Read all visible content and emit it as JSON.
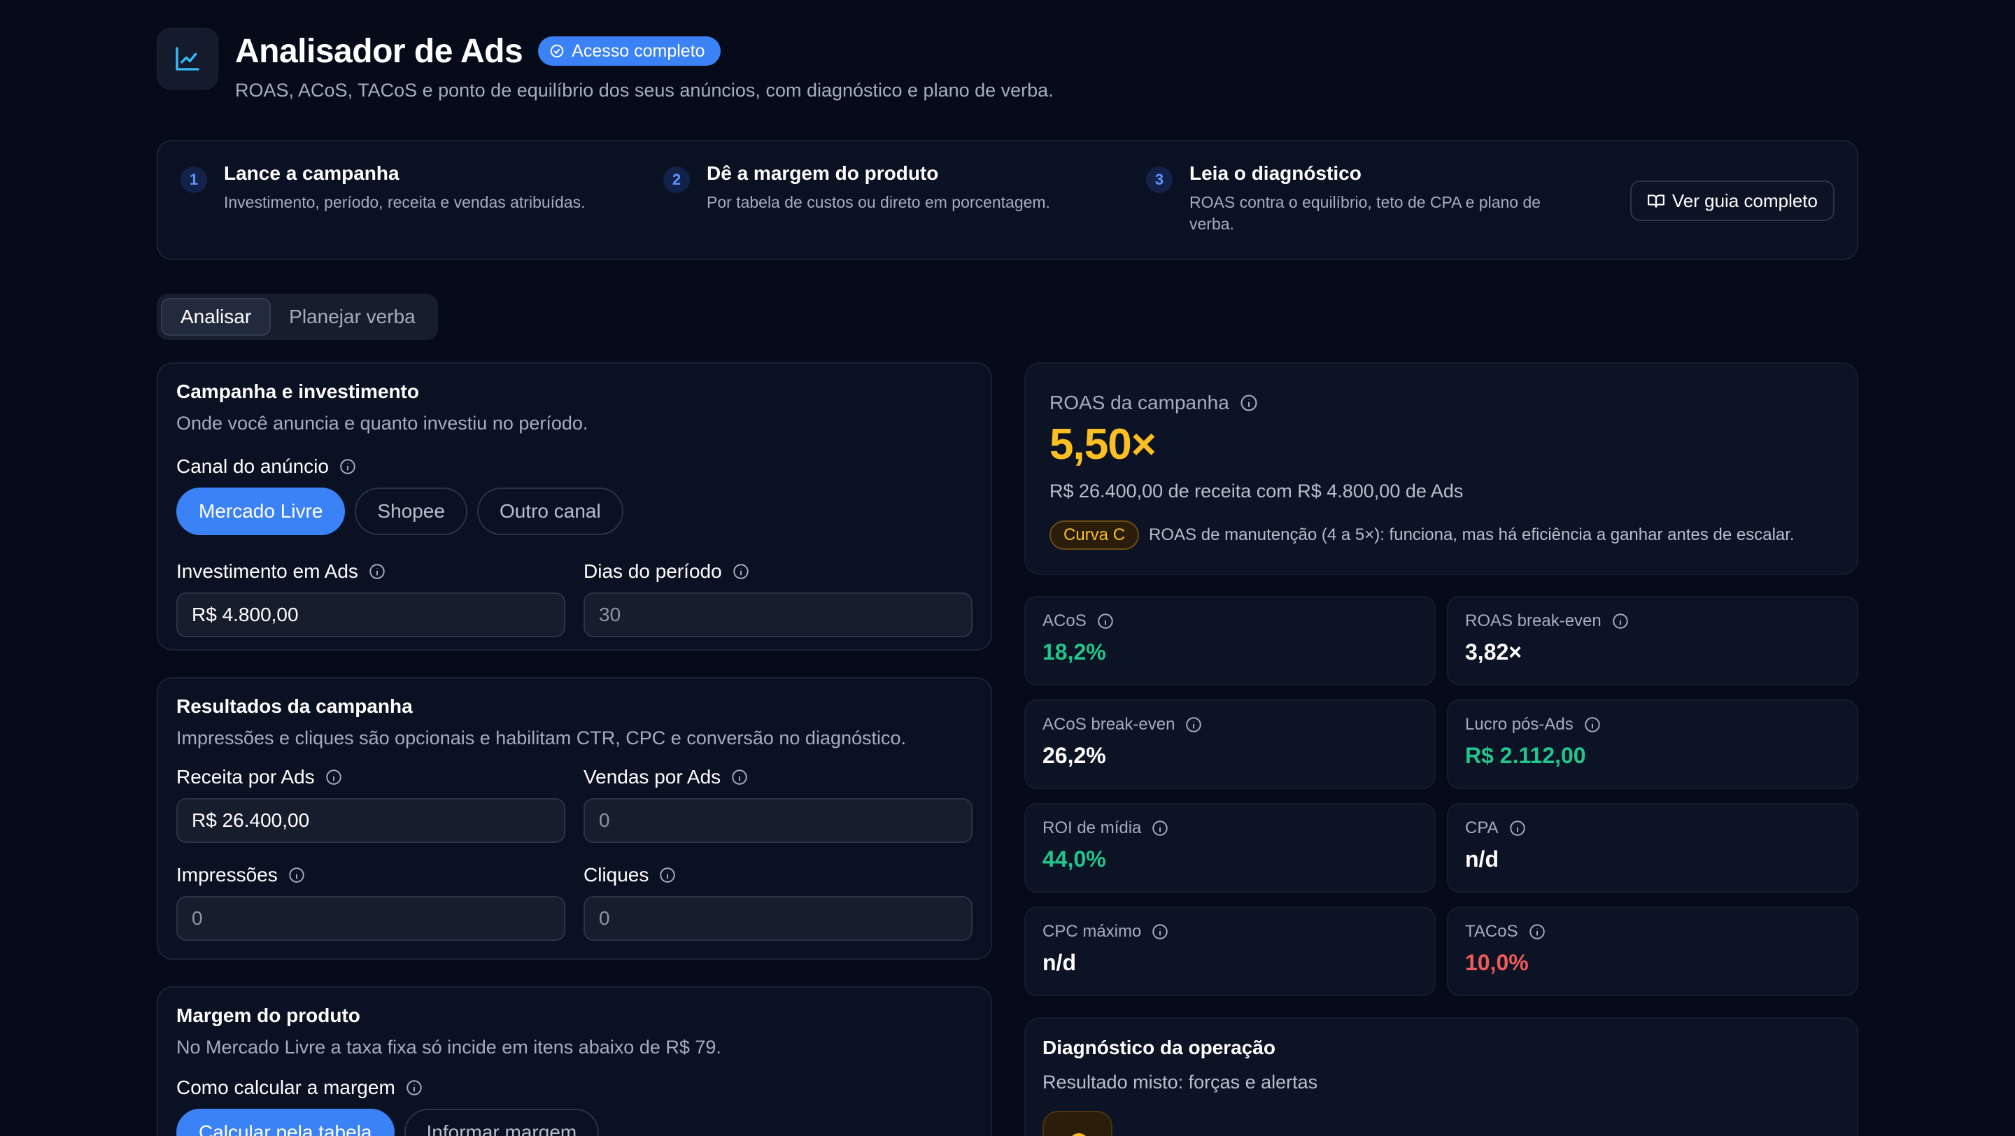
{
  "header": {
    "title": "Analisador de Ads",
    "badge": "Acesso completo",
    "subtitle": "ROAS, ACoS, TACoS e ponto de equilíbrio dos seus anúncios, com diagnóstico e plano de verba."
  },
  "steps": [
    {
      "num": "1",
      "title": "Lance a campanha",
      "desc": "Investimento, período, receita e vendas atribuídas."
    },
    {
      "num": "2",
      "title": "Dê a margem do produto",
      "desc": "Por tabela de custos ou direto em porcentagem."
    },
    {
      "num": "3",
      "title": "Leia o diagnóstico",
      "desc": "ROAS contra o equilíbrio, teto de CPA e plano de verba."
    }
  ],
  "guide_button": "Ver guia completo",
  "tabs": [
    "Analisar",
    "Planejar verba"
  ],
  "campaign": {
    "title": "Campanha e investimento",
    "subtitle": "Onde você anuncia e quanto investiu no período.",
    "channel_label": "Canal do anúncio",
    "channels": [
      "Mercado Livre",
      "Shopee",
      "Outro canal"
    ],
    "investment_label": "Investimento em Ads",
    "investment_value": "R$ 4.800,00",
    "days_label": "Dias do período",
    "days_value": "30"
  },
  "results": {
    "title": "Resultados da campanha",
    "subtitle": "Impressões e cliques são opcionais e habilitam CTR, CPC e conversão no diagnóstico.",
    "revenue_label": "Receita por Ads",
    "revenue_value": "R$ 26.400,00",
    "sales_label": "Vendas por Ads",
    "sales_value": "0",
    "impressions_label": "Impressões",
    "impressions_value": "0",
    "clicks_label": "Cliques",
    "clicks_value": "0"
  },
  "margin": {
    "title": "Margem do produto",
    "subtitle": "No Mercado Livre a taxa fixa só incide em itens abaixo de R$ 79.",
    "method_label": "Como calcular a margem",
    "methods": [
      "Calcular pela tabela",
      "Informar margem"
    ]
  },
  "roas": {
    "label": "ROAS da campanha",
    "value": "5,50×",
    "desc": "R$ 26.400,00 de receita com R$ 4.800,00 de Ads",
    "curve": "Curva C",
    "curve_text": "ROAS de manutenção (4 a 5×): funciona, mas há eficiência a ganhar antes de escalar."
  },
  "metrics": [
    {
      "label": "ACoS",
      "value": "18,2%",
      "tone": "green"
    },
    {
      "label": "ROAS break-even",
      "value": "3,82×",
      "tone": "white"
    },
    {
      "label": "ACoS break-even",
      "value": "26,2%",
      "tone": "white"
    },
    {
      "label": "Lucro pós-Ads",
      "value": "R$ 2.112,00",
      "tone": "green"
    },
    {
      "label": "ROI de mídia",
      "value": "44,0%",
      "tone": "green"
    },
    {
      "label": "CPA",
      "value": "n/d",
      "tone": "white"
    },
    {
      "label": "CPC máximo",
      "value": "n/d",
      "tone": "white"
    },
    {
      "label": "TACoS",
      "value": "10,0%",
      "tone": "red"
    }
  ],
  "diagnosis": {
    "title": "Diagnóstico da operação",
    "subtitle": "Resultado misto: forças e alertas"
  },
  "colors": {
    "accent": "#3b82f6",
    "warning": "#fbbf24",
    "positive": "#22c58b",
    "negative": "#f05a5a"
  }
}
